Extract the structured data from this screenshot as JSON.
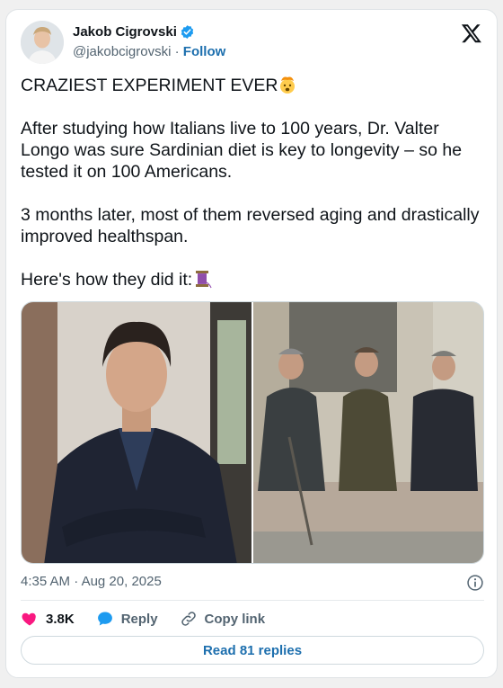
{
  "author": {
    "name": "Jakob Cigrovski",
    "handle": "@jakobcigrovski",
    "separator": " · ",
    "follow_label": "Follow"
  },
  "tweet": {
    "paragraphs": [
      "CRAZIEST EXPERIMENT EVER",
      "After studying how Italians live to 100 years, Dr. Valter Longo was sure Sardinian diet is key to longevity – so he tested it on 100 Americans.",
      "3 months later, most of them reversed aging and drastically improved healthspan.",
      "Here's how they did it:"
    ],
    "emoji_1": "exploding-head-emoji",
    "emoji_2": "thread-spool-emoji"
  },
  "meta": {
    "time": "4:35 AM",
    "separator": " · ",
    "date": "Aug 20, 2025"
  },
  "actions": {
    "likes": "3.8K",
    "reply_label": "Reply",
    "copy_link_label": "Copy link"
  },
  "read_replies_label": "Read 81 replies",
  "colors": {
    "accent": "#1d6fae",
    "like": "#f91880",
    "verified": "#1d9bf0",
    "muted": "#536471"
  }
}
